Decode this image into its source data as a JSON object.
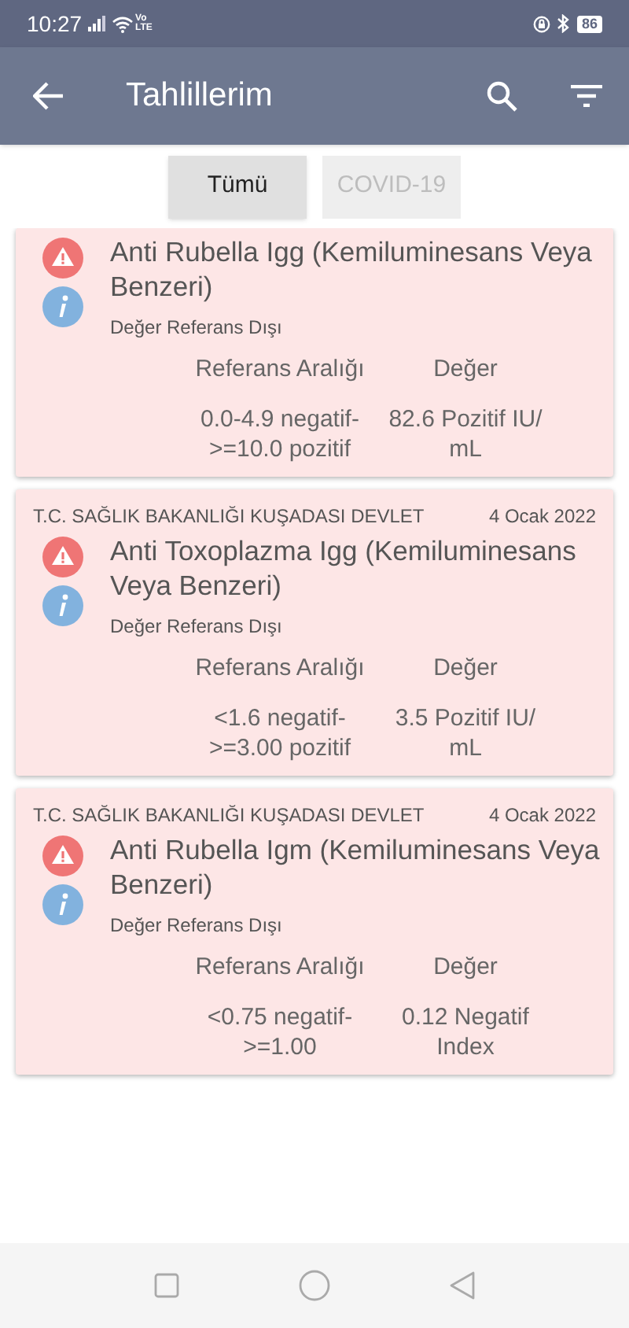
{
  "status_bar": {
    "time": "10:27",
    "network": [
      "Vo",
      "LTE"
    ],
    "battery": "86"
  },
  "app_bar": {
    "title": "Tahlillerim"
  },
  "tabs": [
    {
      "label": "Tümü",
      "selected": true
    },
    {
      "label": "COVID-19",
      "selected": false
    }
  ],
  "results": [
    {
      "title": "Anti Rubella Igg (Kemiluminesans Veya Benzeri)",
      "status": "Değer Referans Dışı",
      "out_of_range": true,
      "columns": [
        "Referans Aralığı",
        "Değer"
      ],
      "reference": "0.0-4.9 negatif->=10.0 pozitif",
      "value": "82.6 Pozitif IU/ mL"
    },
    {
      "hospital": "T.C. SAĞLIK BAKANLIĞI KUŞADASI DEVLET",
      "date": "4 Ocak 2022",
      "title": "Anti Toxoplazma Igg (Kemiluminesans Veya Benzeri)",
      "status": "Değer Referans Dışı",
      "out_of_range": true,
      "columns": [
        "Referans Aralığı",
        "Değer"
      ],
      "reference": "<1.6 negatif->=3.00 pozitif",
      "value": "3.5 Pozitif IU/ mL"
    },
    {
      "hospital": "T.C. SAĞLIK BAKANLIĞI KUŞADASI DEVLET",
      "date": "4 Ocak 2022",
      "title": "Anti Rubella Igm (Kemiluminesans Veya Benzeri)",
      "status": "Değer Referans Dışı",
      "out_of_range": true,
      "columns": [
        "Referans Aralığı",
        "Değer"
      ],
      "reference": "<0.75 negatif->=1.00",
      "value": "0.12 Negatif Index"
    }
  ]
}
